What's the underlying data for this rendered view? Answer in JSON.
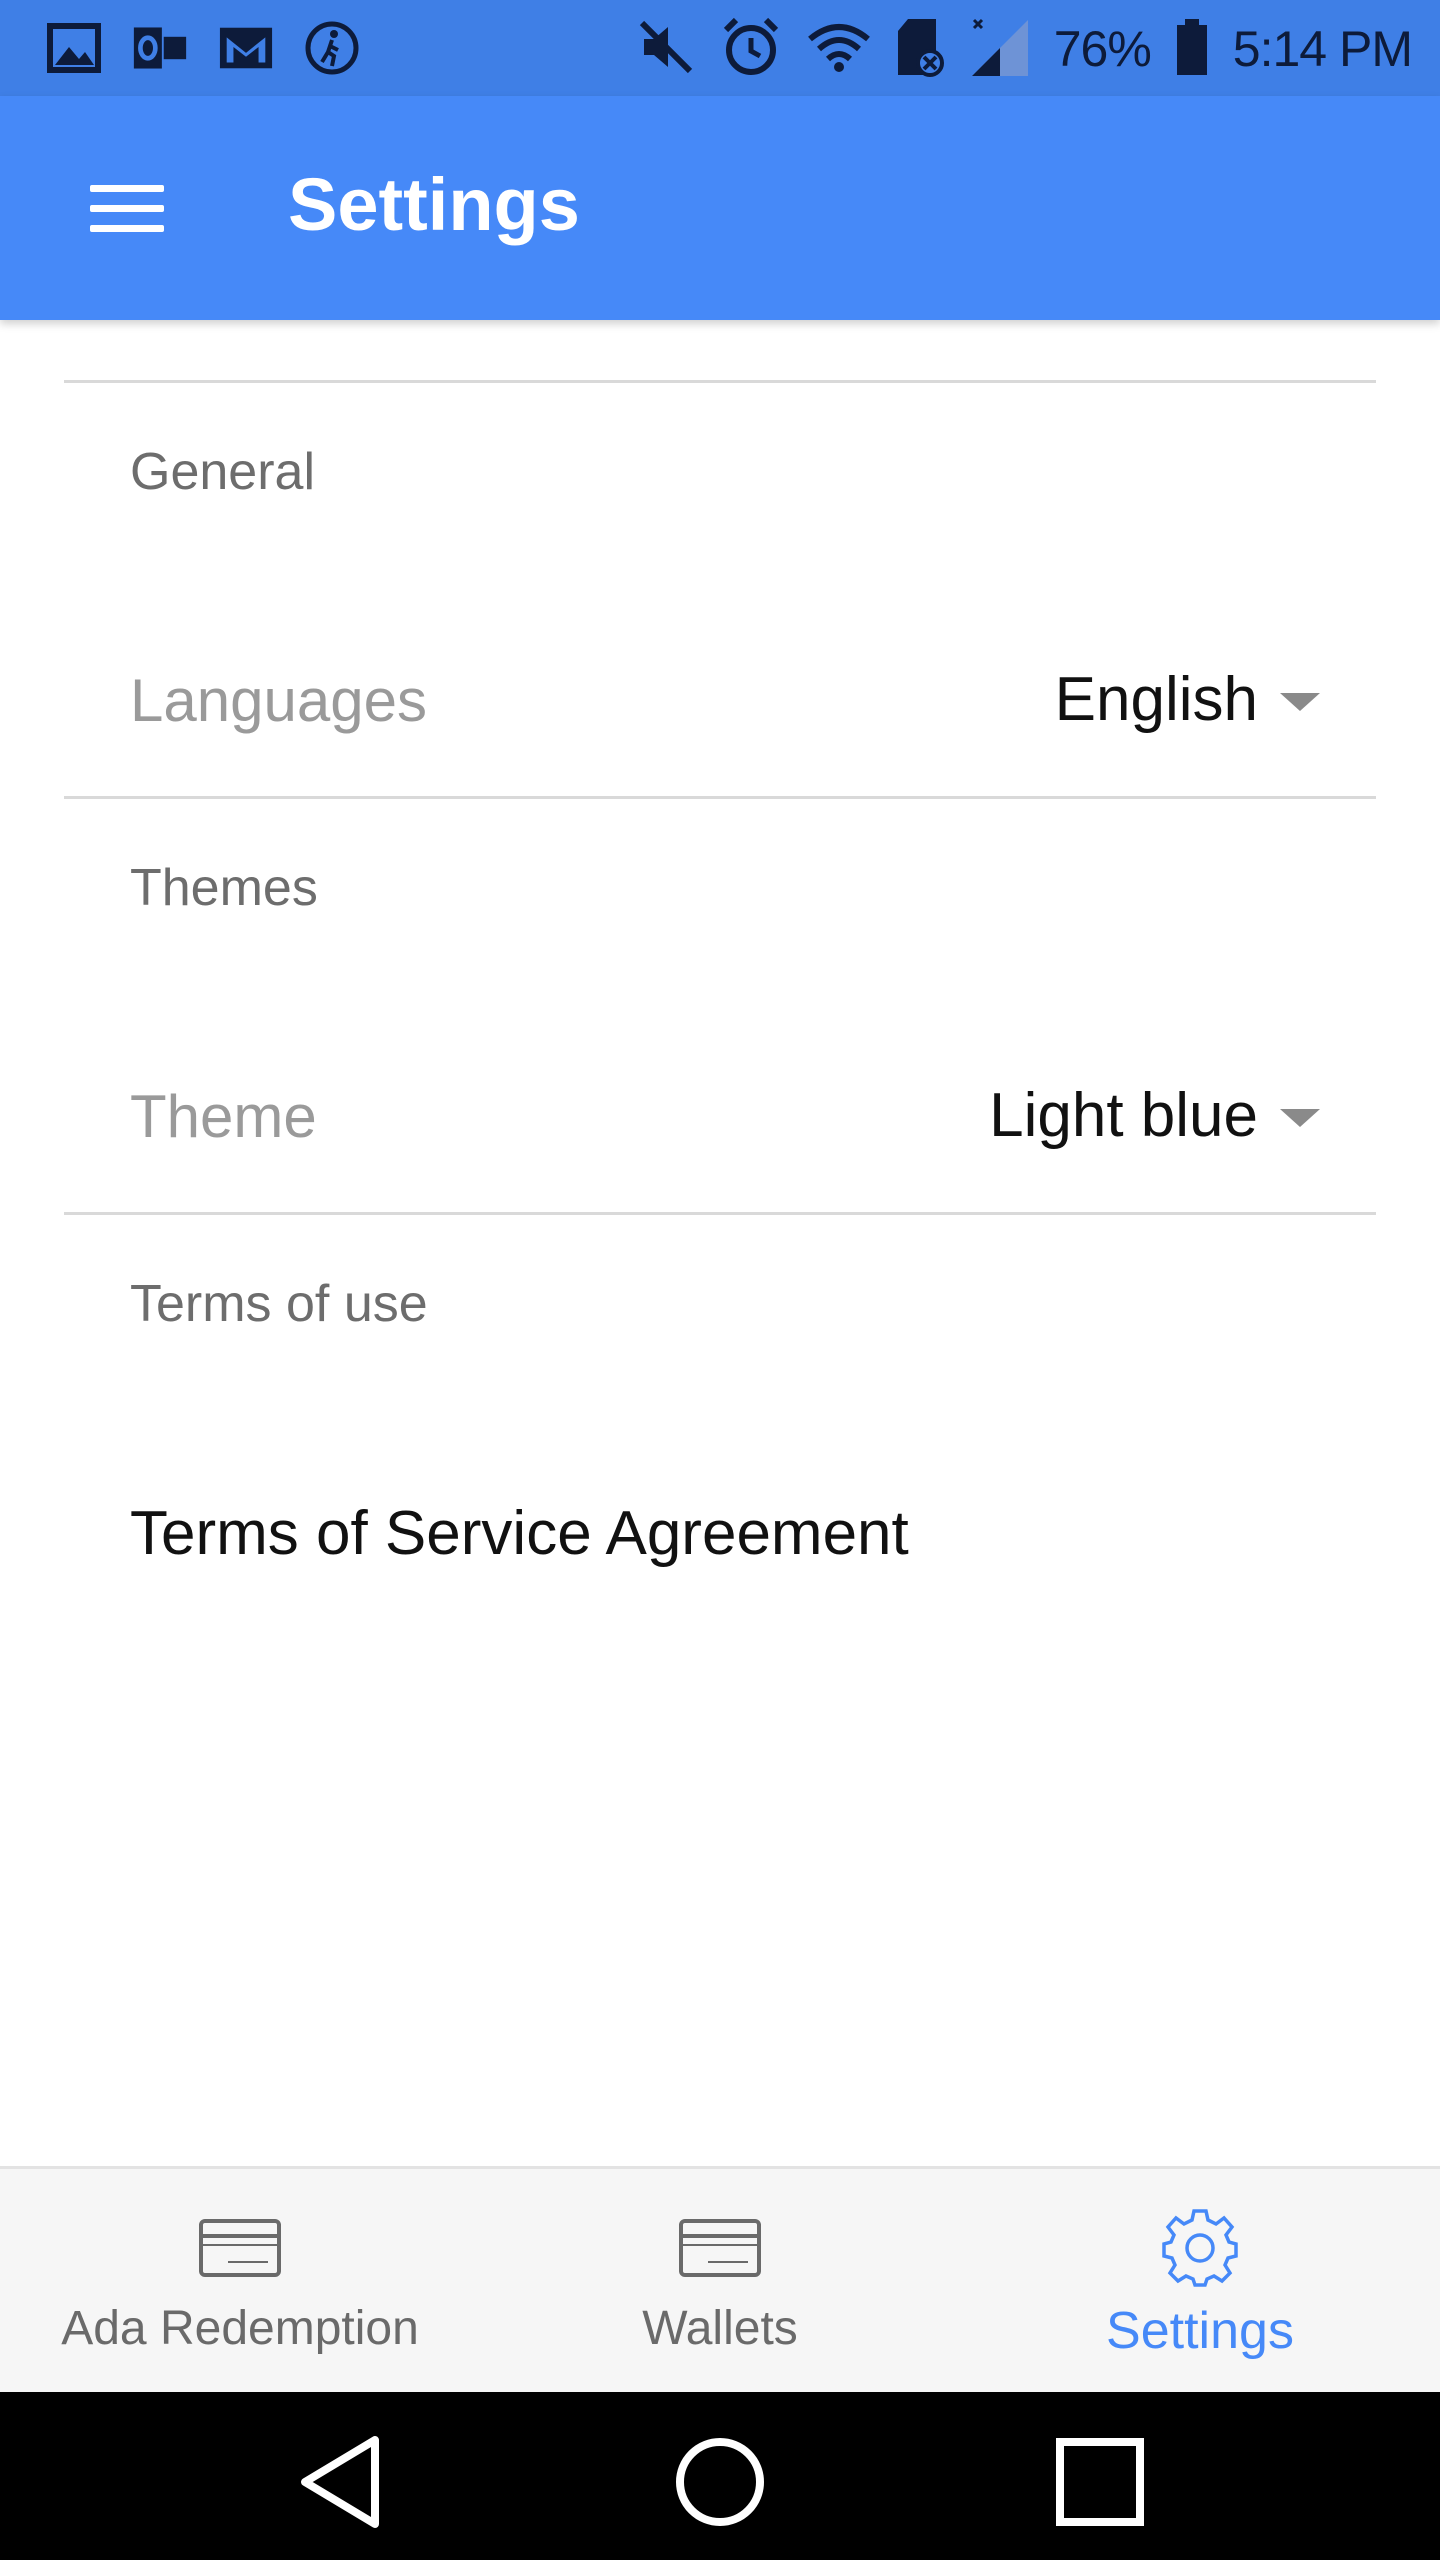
{
  "status_bar": {
    "left_icons": [
      "image-icon",
      "outlook-icon",
      "gmail-icon",
      "walk-icon"
    ],
    "right_icons": [
      "mute-icon",
      "alarm-icon",
      "wifi-icon",
      "sd-card-icon",
      "signal-icon"
    ],
    "battery": "76%",
    "time": "5:14 PM"
  },
  "app_bar": {
    "title": "Settings",
    "menu_icon": "hamburger-menu-icon",
    "bg_color": "#4689f8"
  },
  "sections": {
    "general": {
      "title": "General",
      "row_label": "Languages",
      "value": "English"
    },
    "themes": {
      "title": "Themes",
      "row_label": "Theme",
      "value": "Light blue"
    },
    "terms": {
      "title": "Terms of use",
      "link": "Terms of Service Agreement"
    }
  },
  "bottom_nav": {
    "items": [
      {
        "label": "Ada Redemption",
        "icon": "card-icon",
        "active": false
      },
      {
        "label": "Wallets",
        "icon": "card-icon",
        "active": false
      },
      {
        "label": "Settings",
        "icon": "gear-icon",
        "active": true
      }
    ],
    "active_color": "#4689f8"
  },
  "system_nav": {
    "buttons": [
      "back-icon",
      "home-icon",
      "recents-icon"
    ]
  }
}
